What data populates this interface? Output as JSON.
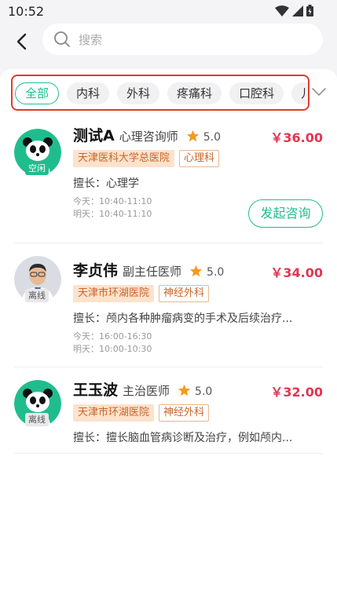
{
  "status_bar": {
    "time": "10:52"
  },
  "search": {
    "placeholder": "搜索"
  },
  "filters": {
    "chips": [
      "全部",
      "内科",
      "外科",
      "疼痛科",
      "口腔科",
      "儿"
    ],
    "active_index": 0
  },
  "colors": {
    "accent": "#1fbd8e",
    "price": "#e4344f",
    "highlight_border": "#e03b2a",
    "star": "#f59a1b"
  },
  "doctors": [
    {
      "name": "测试A",
      "title": "心理咨询师",
      "rating": "5.0",
      "price": "￥36.00",
      "hospital": "天津医科大学总医院",
      "department": "心理科",
      "specialty": "擅长：心理学",
      "schedule_today": "今天：10:40-11:10",
      "schedule_tomorrow": "明天：10:40-11:10",
      "status": "空闲",
      "avatar": "panda-avatar",
      "consult_label": "发起咨询"
    },
    {
      "name": "李贞伟",
      "title": "副主任医师",
      "rating": "5.0",
      "price": "￥34.00",
      "hospital": "天津市环湖医院",
      "department": "神经外科",
      "specialty": "擅长：颅内各种肿瘤病变的手术及后续治疗...",
      "schedule_today": "今天：16:00-16:30",
      "schedule_tomorrow": "明天：10:00-10:30",
      "status": "离线",
      "avatar": "doctor-photo"
    },
    {
      "name": "王玉波",
      "title": "主治医师",
      "rating": "5.0",
      "price": "￥32.00",
      "hospital": "天津市环湖医院",
      "department": "神经外科",
      "specialty": "擅长：擅长脑血管病诊断及治疗，例如颅内...",
      "status": "离线",
      "avatar": "panda-avatar"
    }
  ]
}
